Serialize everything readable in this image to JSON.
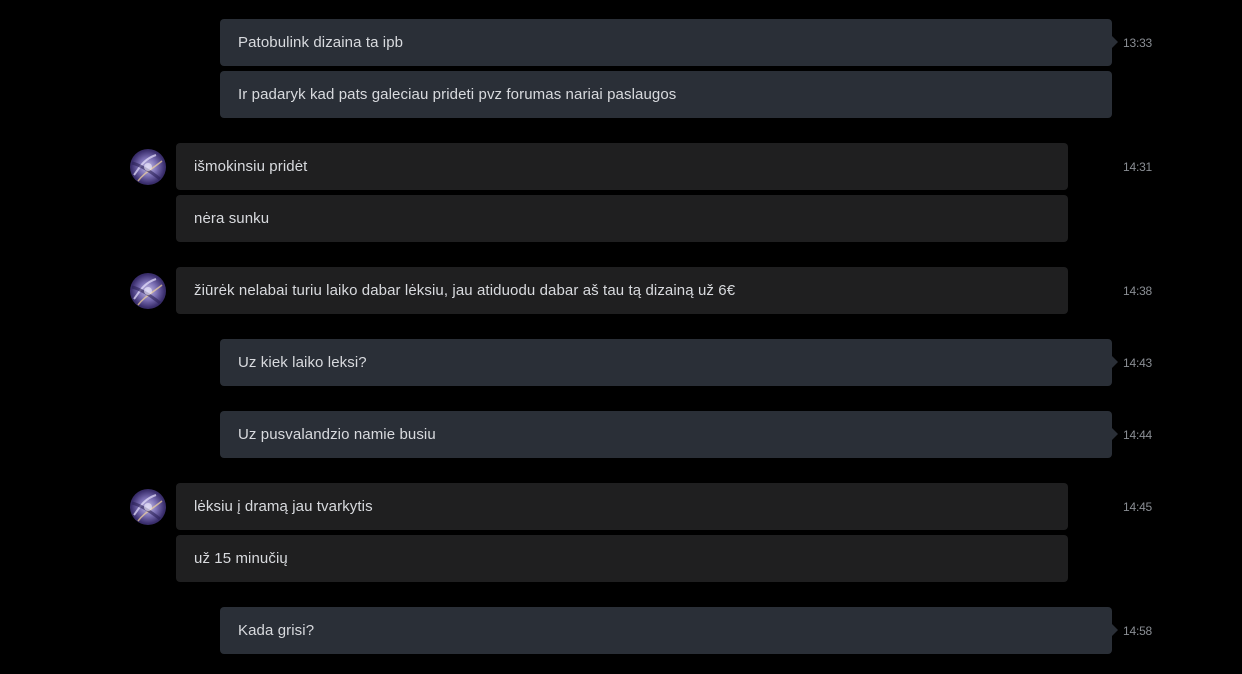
{
  "messages": [
    {
      "dir": "out",
      "text": "Patobulink dizaina ta ipb",
      "time": "13:33"
    },
    {
      "dir": "out",
      "text": "Ir padaryk kad pats galeciau prideti pvz forumas nariai paslaugos"
    },
    {
      "dir": "in",
      "text": "išmokinsiu pridėt",
      "time": "14:31"
    },
    {
      "dir": "in",
      "text": "nėra sunku"
    },
    {
      "dir": "in",
      "text": "žiūrėk nelabai turiu laiko dabar lėksiu, jau atiduodu dabar aš tau tą dizainą už 6€",
      "time": "14:38"
    },
    {
      "dir": "out",
      "text": "Uz kiek laiko leksi?",
      "time": "14:43"
    },
    {
      "dir": "out",
      "text": "Uz pusvalandzio namie busiu",
      "time": "14:44"
    },
    {
      "dir": "in",
      "text": "lėksiu į dramą jau tvarkytis",
      "time": "14:45"
    },
    {
      "dir": "in",
      "text": "už 15 minučių"
    },
    {
      "dir": "out",
      "text": "Kada grisi?",
      "time": "14:58"
    }
  ],
  "avatar": {
    "icon": "user-avatar-icon"
  },
  "colors": {
    "background": "#000000",
    "outgoing_bubble": "#2a2f37",
    "incoming_bubble": "#1f1f20",
    "text": "#d8dade",
    "timestamp": "#8a8e94"
  }
}
